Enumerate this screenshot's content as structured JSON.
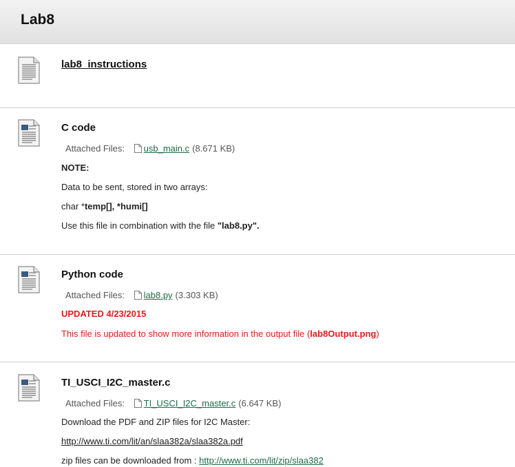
{
  "page": {
    "title": "Lab8"
  },
  "items": [
    {
      "title": "lab8_instructions",
      "icon": "document-icon"
    },
    {
      "title": "C code",
      "icon": "text-document-icon",
      "attached_label": "Attached Files:",
      "file_name": "usb_main.c",
      "file_size": "(8.671 KB)",
      "lines": {
        "note": "NOTE:",
        "data_desc": "Data to be sent, stored in two arrays:",
        "char_prefix": "char *",
        "char_bold": "temp[], *humi[]",
        "use_prefix": "Use this file in combination with the file ",
        "use_bold": "\"lab8.py\"."
      }
    },
    {
      "title": "Python code",
      "icon": "text-document-icon",
      "attached_label": "Attached Files:",
      "file_name": "lab8.py",
      "file_size": "(3.303 KB)",
      "lines": {
        "updated": "UPDATED 4/23/2015",
        "info_prefix": "This file is updated to show more information in the output file (",
        "info_bold": "lab8Output.png",
        "info_suffix": ")"
      }
    },
    {
      "title": "TI_USCI_I2C_master.c",
      "icon": "text-document-icon",
      "attached_label": "Attached Files:",
      "file_name": "TI_USCI_I2C_master.c",
      "file_size": "(6.647 KB)",
      "lines": {
        "download": "Download the PDF and ZIP files for I2C Master:",
        "pdf_url": "http://www.ti.com/lit/an/slaa382a/slaa382a.pdf",
        "zip_prefix": "zip files can be downloaded from : ",
        "zip_url": "http://www.ti.com/lit/zip/slaa382"
      }
    }
  ]
}
